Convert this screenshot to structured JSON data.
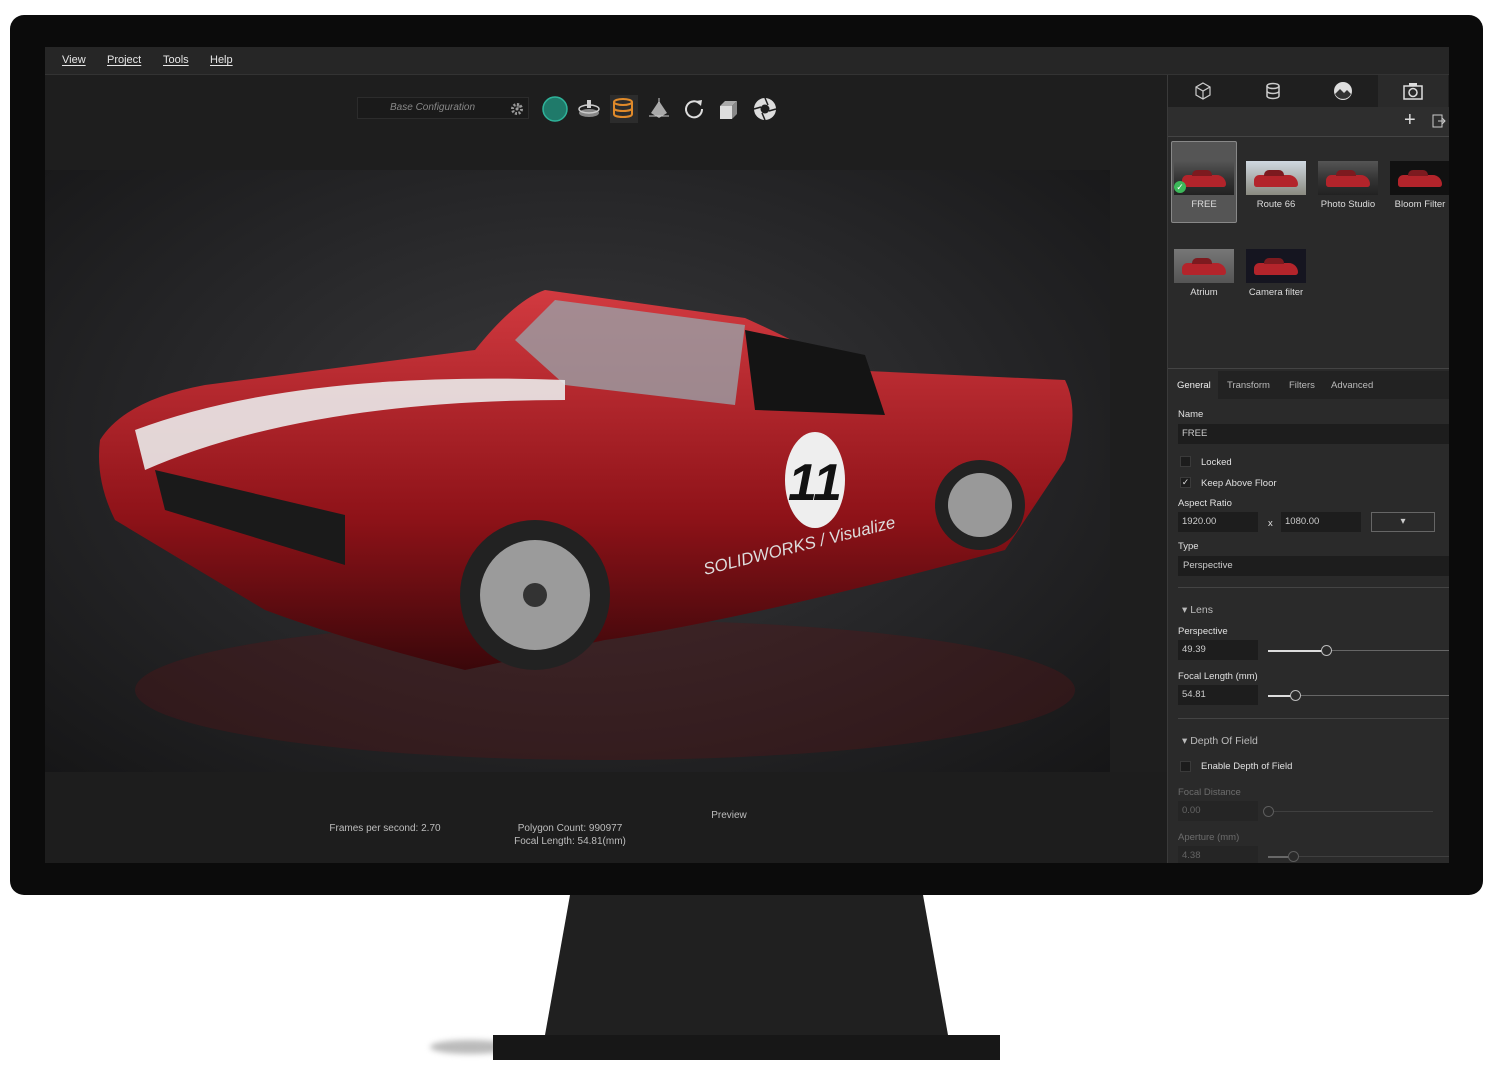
{
  "menu": [
    "View",
    "Project",
    "Tools",
    "Help"
  ],
  "toolbar": {
    "configuration": "Base Configuration",
    "icons": [
      "gear-icon",
      "environment-sphere-icon",
      "turntable-icon",
      "appearance-library-icon",
      "scene-object-icon",
      "reset-rotate-icon",
      "import-box-icon",
      "render-aperture-icon"
    ],
    "accent": "#1f8a78",
    "active": "#e08a2a"
  },
  "status": {
    "fps": "Frames per second: 2.70",
    "polygons": "Polygon Count: 990977",
    "focal": "Focal Length: 54.81(mm)",
    "mode": "Preview"
  },
  "panel": {
    "tabs": [
      "model-icon",
      "appearance-icon",
      "scene-icon",
      "camera-icon"
    ],
    "cameras": [
      {
        "label": "FREE",
        "selected": true
      },
      {
        "label": "Route 66"
      },
      {
        "label": "Photo Studio"
      },
      {
        "label": "Bloom Filter"
      },
      {
        "label": "Atrium"
      },
      {
        "label": "Camera filter"
      }
    ],
    "subtabs": [
      "General",
      "Transform",
      "Filters",
      "Advanced"
    ],
    "general": {
      "name_label": "Name",
      "name_value": "FREE",
      "locked_label": "Locked",
      "locked": false,
      "keep_label": "Keep Above Floor",
      "keep": true,
      "aspect_label": "Aspect Ratio",
      "width": "1920.00",
      "x": "x",
      "height": "1080.00",
      "type_label": "Type",
      "type_value": "Perspective",
      "lens_header": "Lens",
      "perspective_label": "Perspective",
      "perspective_value": "49.39",
      "perspective_slider": 0.32,
      "focal_label": "Focal Length (mm)",
      "focal_value": "54.81",
      "focal_slider": 0.15,
      "dof_header": "Depth Of Field",
      "dof_label": "Enable Depth of Field",
      "dof": false,
      "focal_distance_label": "Focal Distance",
      "focal_distance_value": "0.00",
      "focal_distance_slider": 0.0,
      "aperture_label": "Aperture (mm)",
      "aperture_value": "4.38",
      "aperture_slider": 0.14
    }
  },
  "viewport": {
    "car_number": "11",
    "car_decal": "SOLIDWORKS / Visualize",
    "car_color": "#a8141c"
  }
}
